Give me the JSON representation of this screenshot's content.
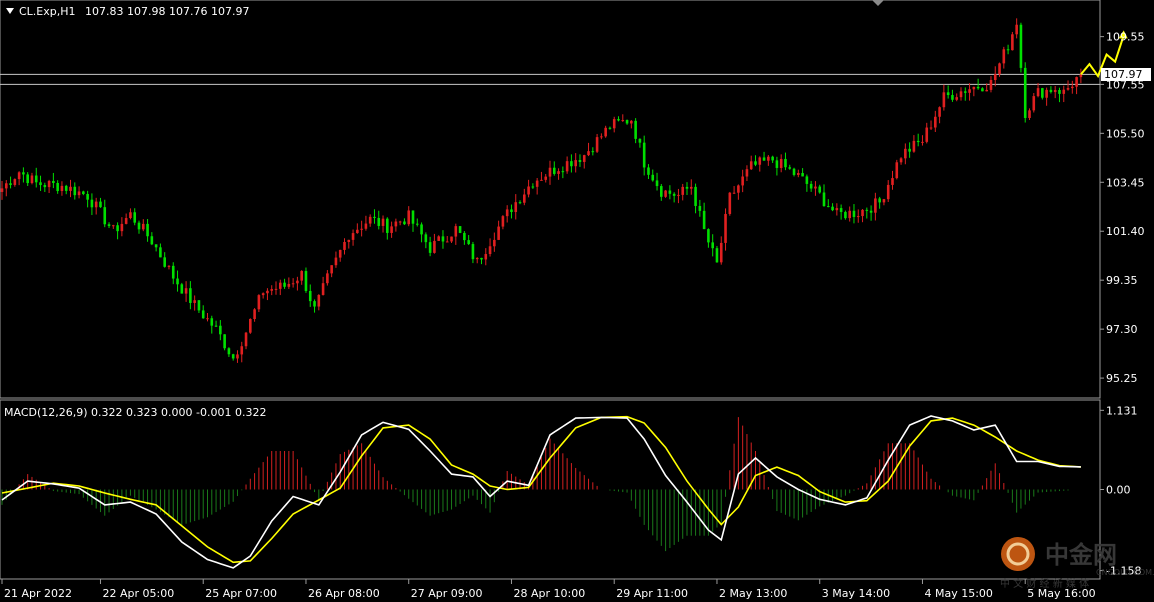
{
  "header": {
    "symbol": "CL.Exp,H1",
    "ohlc": "107.83 107.98 107.76 107.97"
  },
  "macd_header": "MACD(12,26,9) 0.322 0.323 0.000 -0.001 0.322",
  "current_price_label": "107.97",
  "watermark": {
    "brand": "中金网",
    "sub": "中 文 财 经 新 媒 体",
    "url": "CNGOLD.COM.CN"
  },
  "colors": {
    "background": "#000000",
    "bull_candle": "#e02020",
    "bear_candle": "#00e000",
    "macd_line": "#ffffff",
    "signal_line": "#ffff00",
    "hist_pos": "#d42020",
    "hist_neg": "#1a7a1a",
    "forecast_arrow": "#ffff00"
  },
  "chart_data": [
    {
      "type": "candlestick",
      "title": "CL.Exp,H1",
      "y_ticks": [
        "109.55",
        "107.55",
        "105.50",
        "103.45",
        "101.40",
        "99.35",
        "97.30",
        "95.25"
      ],
      "y_tick_values": [
        109.55,
        107.55,
        105.5,
        103.45,
        101.4,
        99.35,
        97.3,
        95.25
      ],
      "ylim": [
        94.5,
        111.0
      ],
      "x_ticks": [
        "21 Apr 2022",
        "22 Apr 05:00",
        "25 Apr 07:00",
        "26 Apr 08:00",
        "27 Apr 09:00",
        "28 Apr 10:00",
        "29 Apr 11:00",
        "2 May 13:00",
        "3 May 14:00",
        "4 May 15:00",
        "5 May 16:00"
      ],
      "x_tick_index": [
        0,
        23,
        47,
        71,
        95,
        119,
        143,
        167,
        191,
        215,
        239
      ],
      "horizontal_lines": [
        107.97,
        107.55
      ],
      "close_anchors": [
        [
          0,
          103.2
        ],
        [
          4,
          103.9
        ],
        [
          8,
          103.4
        ],
        [
          14,
          103.3
        ],
        [
          20,
          102.9
        ],
        [
          26,
          101.4
        ],
        [
          30,
          102.1
        ],
        [
          35,
          101.0
        ],
        [
          40,
          99.5
        ],
        [
          45,
          98.3
        ],
        [
          50,
          97.3
        ],
        [
          54,
          96.1
        ],
        [
          57,
          97.2
        ],
        [
          61,
          98.9
        ],
        [
          66,
          99.1
        ],
        [
          70,
          99.6
        ],
        [
          73,
          98.1
        ],
        [
          76,
          99.4
        ],
        [
          81,
          101.3
        ],
        [
          86,
          101.9
        ],
        [
          90,
          101.6
        ],
        [
          95,
          102.0
        ],
        [
          100,
          100.7
        ],
        [
          106,
          101.5
        ],
        [
          111,
          100.1
        ],
        [
          115,
          101.3
        ],
        [
          119,
          102.4
        ],
        [
          124,
          103.5
        ],
        [
          130,
          104.1
        ],
        [
          136,
          104.6
        ],
        [
          142,
          105.8
        ],
        [
          147,
          106.1
        ],
        [
          150,
          104.3
        ],
        [
          154,
          103.1
        ],
        [
          158,
          102.9
        ],
        [
          161,
          103.3
        ],
        [
          164,
          101.4
        ],
        [
          167,
          100.0
        ],
        [
          170,
          102.8
        ],
        [
          175,
          104.1
        ],
        [
          180,
          104.4
        ],
        [
          186,
          103.7
        ],
        [
          191,
          102.9
        ],
        [
          195,
          102.1
        ],
        [
          200,
          102.2
        ],
        [
          205,
          102.6
        ],
        [
          210,
          104.6
        ],
        [
          215,
          105.2
        ],
        [
          220,
          107.0
        ],
        [
          226,
          107.4
        ],
        [
          231,
          107.6
        ],
        [
          235,
          109.2
        ],
        [
          237,
          110.2
        ],
        [
          239,
          106.4
        ],
        [
          242,
          107.2
        ],
        [
          246,
          107.4
        ],
        [
          248,
          107.2
        ],
        [
          250,
          107.6
        ],
        [
          252,
          107.97
        ]
      ],
      "forecast_arrow": [
        [
          252,
          107.97
        ],
        [
          254,
          108.4
        ],
        [
          256,
          107.9
        ],
        [
          258,
          108.8
        ],
        [
          260,
          108.5
        ],
        [
          262,
          109.6
        ]
      ]
    },
    {
      "type": "macd",
      "title": "MACD(12,26,9)",
      "values": {
        "macd": 0.322,
        "signal": 0.323,
        "histogram_a": 0.0,
        "histogram_b": -0.001,
        "last": 0.322
      },
      "y_ticks": [
        "1.131",
        "0.00",
        "-1.158"
      ],
      "y_tick_values": [
        1.131,
        0.0,
        -1.158
      ],
      "ylim": [
        -1.25,
        1.25
      ],
      "macd_anchors": [
        [
          0,
          -0.15
        ],
        [
          6,
          0.12
        ],
        [
          12,
          0.08
        ],
        [
          18,
          0.02
        ],
        [
          24,
          -0.22
        ],
        [
          30,
          -0.18
        ],
        [
          36,
          -0.35
        ],
        [
          42,
          -0.75
        ],
        [
          48,
          -1.0
        ],
        [
          54,
          -1.12
        ],
        [
          58,
          -0.95
        ],
        [
          63,
          -0.45
        ],
        [
          68,
          -0.1
        ],
        [
          74,
          -0.22
        ],
        [
          79,
          0.25
        ],
        [
          84,
          0.78
        ],
        [
          89,
          0.96
        ],
        [
          95,
          0.86
        ],
        [
          100,
          0.55
        ],
        [
          105,
          0.22
        ],
        [
          110,
          0.18
        ],
        [
          114,
          -0.1
        ],
        [
          118,
          0.12
        ],
        [
          123,
          0.06
        ],
        [
          128,
          0.78
        ],
        [
          134,
          1.02
        ],
        [
          140,
          1.03
        ],
        [
          146,
          1.02
        ],
        [
          150,
          0.72
        ],
        [
          155,
          0.2
        ],
        [
          160,
          -0.18
        ],
        [
          165,
          -0.58
        ],
        [
          168,
          -0.72
        ],
        [
          172,
          0.22
        ],
        [
          176,
          0.45
        ],
        [
          181,
          0.18
        ],
        [
          186,
          0.0
        ],
        [
          191,
          -0.14
        ],
        [
          197,
          -0.22
        ],
        [
          202,
          -0.12
        ],
        [
          207,
          0.42
        ],
        [
          212,
          0.92
        ],
        [
          217,
          1.05
        ],
        [
          222,
          0.98
        ],
        [
          227,
          0.85
        ],
        [
          232,
          0.92
        ],
        [
          237,
          0.4
        ],
        [
          242,
          0.4
        ],
        [
          247,
          0.33
        ],
        [
          252,
          0.322
        ]
      ],
      "signal_anchors": [
        [
          0,
          -0.05
        ],
        [
          6,
          0.02
        ],
        [
          12,
          0.09
        ],
        [
          18,
          0.05
        ],
        [
          24,
          -0.05
        ],
        [
          30,
          -0.14
        ],
        [
          36,
          -0.22
        ],
        [
          42,
          -0.52
        ],
        [
          48,
          -0.82
        ],
        [
          54,
          -1.04
        ],
        [
          58,
          -1.02
        ],
        [
          63,
          -0.7
        ],
        [
          68,
          -0.35
        ],
        [
          74,
          -0.15
        ],
        [
          79,
          0.02
        ],
        [
          84,
          0.48
        ],
        [
          89,
          0.88
        ],
        [
          95,
          0.92
        ],
        [
          100,
          0.72
        ],
        [
          105,
          0.35
        ],
        [
          110,
          0.22
        ],
        [
          114,
          0.05
        ],
        [
          118,
          0.0
        ],
        [
          123,
          0.03
        ],
        [
          128,
          0.45
        ],
        [
          134,
          0.88
        ],
        [
          140,
          1.03
        ],
        [
          146,
          1.04
        ],
        [
          150,
          0.95
        ],
        [
          155,
          0.6
        ],
        [
          160,
          0.12
        ],
        [
          165,
          -0.28
        ],
        [
          168,
          -0.5
        ],
        [
          172,
          -0.25
        ],
        [
          176,
          0.2
        ],
        [
          181,
          0.32
        ],
        [
          186,
          0.2
        ],
        [
          191,
          -0.03
        ],
        [
          197,
          -0.18
        ],
        [
          202,
          -0.16
        ],
        [
          207,
          0.12
        ],
        [
          212,
          0.62
        ],
        [
          217,
          0.98
        ],
        [
          222,
          1.02
        ],
        [
          227,
          0.92
        ],
        [
          232,
          0.75
        ],
        [
          237,
          0.55
        ],
        [
          242,
          0.42
        ],
        [
          247,
          0.34
        ],
        [
          252,
          0.323
        ]
      ]
    }
  ]
}
